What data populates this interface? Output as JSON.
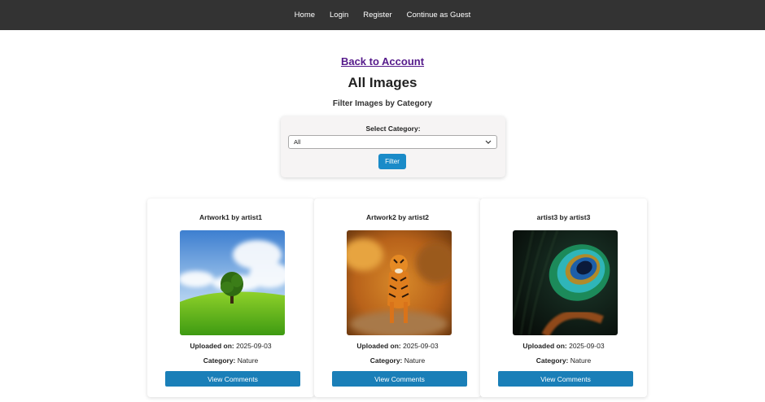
{
  "nav": {
    "items": [
      {
        "label": "Home"
      },
      {
        "label": "Login"
      },
      {
        "label": "Register"
      },
      {
        "label": "Continue as Guest"
      }
    ]
  },
  "back_link": "Back to Account",
  "page_title": "All Images",
  "filter": {
    "heading": "Filter Images by Category",
    "label": "Select Category:",
    "selected": "All",
    "button_label": "Filter"
  },
  "meta_labels": {
    "uploaded": "Uploaded on:",
    "category": "Category:"
  },
  "cards": [
    {
      "title": "Artwork1 by artist1",
      "uploaded": "2025-09-03",
      "category": "Nature",
      "button_label": "View Comments",
      "image": "green-hill-tree"
    },
    {
      "title": "Artwork2 by artist2",
      "uploaded": "2025-09-03",
      "category": "Nature",
      "button_label": "View Comments",
      "image": "tiger"
    },
    {
      "title": "artist3 by artist3",
      "uploaded": "2025-09-03",
      "category": "Nature",
      "button_label": "View Comments",
      "image": "peacock-feather"
    }
  ],
  "colors": {
    "nav_bg": "#333333",
    "link_visited": "#551a8b",
    "button_primary": "#1a7fb8"
  }
}
